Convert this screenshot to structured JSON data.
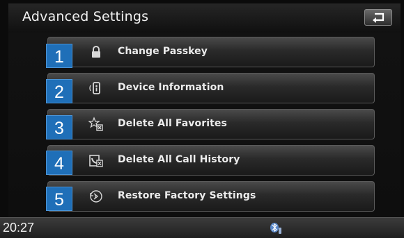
{
  "header": {
    "title": "Advanced Settings",
    "back_icon": "back-arrow-icon"
  },
  "menu": {
    "items": [
      {
        "number": "1",
        "label": "Change Passkey",
        "icon": "lock-icon"
      },
      {
        "number": "2",
        "label": "Device Information",
        "icon": "device-info-icon"
      },
      {
        "number": "3",
        "label": "Delete All Favorites",
        "icon": "delete-favorites-icon"
      },
      {
        "number": "4",
        "label": "Delete All Call History",
        "icon": "delete-call-history-icon"
      },
      {
        "number": "5",
        "label": "Restore Factory Settings",
        "icon": "restore-icon"
      }
    ]
  },
  "statusbar": {
    "time": "20:27",
    "bluetooth_icon": "bluetooth-phone-icon"
  },
  "colors": {
    "badge_blue": "#1f6fb8",
    "background": "#0b0b0b",
    "text": "#ececec"
  }
}
